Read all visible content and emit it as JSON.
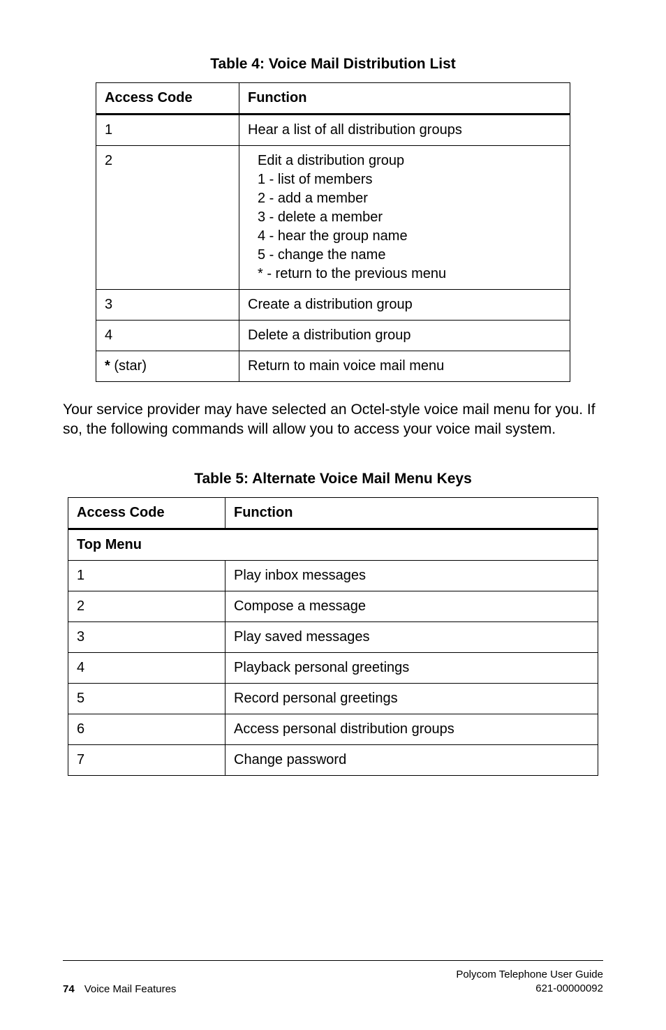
{
  "table4": {
    "title": "Table 4: Voice Mail Distribution List",
    "headers": {
      "access": "Access Code",
      "func": "Function"
    },
    "rows": {
      "r1": {
        "code": "1",
        "func": "Hear a list of all distribution groups"
      },
      "r2": {
        "code": "2",
        "main": "Edit a distribution group",
        "l1": "1 - list of members",
        "l2": "2 - add a member",
        "l3": "3 - delete a member",
        "l4": "4 - hear the group name",
        "l5": "5 - change the name",
        "l6": "* - return to the previous menu"
      },
      "r3": {
        "code": "3",
        "func": "Create a distribution group"
      },
      "r4": {
        "code": "4",
        "func": "Delete a distribution group"
      },
      "r5": {
        "code_prefix": "* ",
        "code_suffix": "(star)",
        "func": "Return to main voice mail menu"
      }
    }
  },
  "paragraph": "Your service provider may have selected an Octel-style voice mail menu for you. If so, the following commands will allow you to access your voice mail system.",
  "table5": {
    "title": "Table 5: Alternate Voice Mail Menu Keys",
    "headers": {
      "access": "Access Code",
      "func": "Function"
    },
    "section": "Top Menu",
    "rows": {
      "r1": {
        "code": "1",
        "func": "Play inbox messages"
      },
      "r2": {
        "code": "2",
        "func": "Compose a message"
      },
      "r3": {
        "code": "3",
        "func": "Play saved messages"
      },
      "r4": {
        "code": "4",
        "func": "Playback personal greetings"
      },
      "r5": {
        "code": "5",
        "func": "Record personal greetings"
      },
      "r6": {
        "code": "6",
        "func": "Access personal distribution groups"
      },
      "r7": {
        "code": "7",
        "func": "Change password"
      }
    }
  },
  "footer": {
    "page": "74",
    "section": "Voice Mail Features",
    "guide": "Polycom Telephone User Guide",
    "docnum": "621-00000092"
  }
}
